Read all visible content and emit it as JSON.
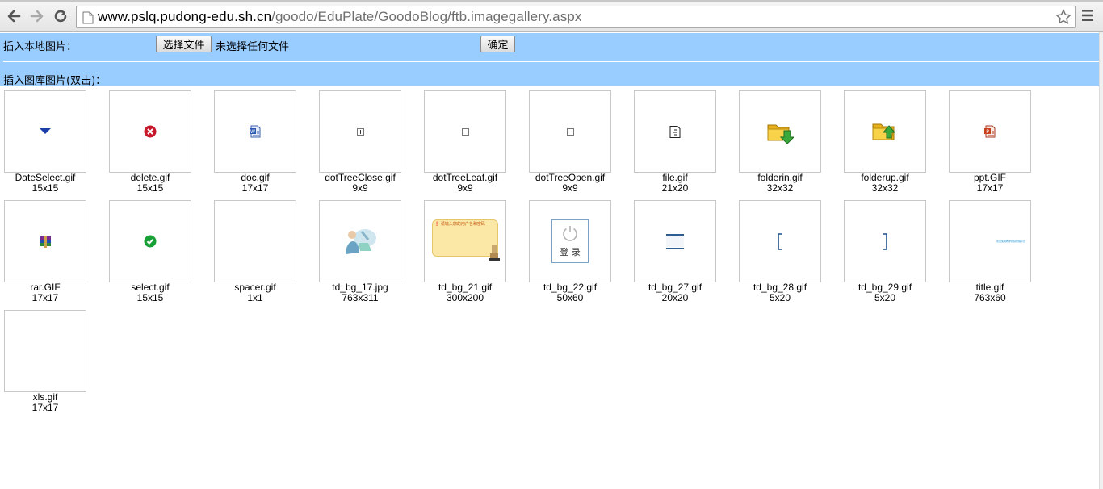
{
  "browser": {
    "url_host": "www.pslq.pudong-edu.sh.cn",
    "url_path": "/goodo/EduPlate/GoodoBlog/ftb.imagegallery.aspx"
  },
  "upload": {
    "label": "插入本地图片：",
    "choose_button": "选择文件",
    "no_file_text": "未选择任何文件",
    "ok_button": "确定"
  },
  "gallery": {
    "label": "插入图库图片(双击)：",
    "images": [
      {
        "name": "DateSelect.gif",
        "size": "15x15",
        "icon": "date-select-icon"
      },
      {
        "name": "delete.gif",
        "size": "15x15",
        "icon": "delete-icon"
      },
      {
        "name": "doc.gif",
        "size": "17x17",
        "icon": "doc-icon"
      },
      {
        "name": "dotTreeClose.gif",
        "size": "9x9",
        "icon": "tree-close-icon"
      },
      {
        "name": "dotTreeLeaf.gif",
        "size": "9x9",
        "icon": "tree-leaf-icon"
      },
      {
        "name": "dotTreeOpen.gif",
        "size": "9x9",
        "icon": "tree-open-icon"
      },
      {
        "name": "file.gif",
        "size": "21x20",
        "icon": "file-icon"
      },
      {
        "name": "folderin.gif",
        "size": "32x32",
        "icon": "folder-in-icon"
      },
      {
        "name": "folderup.gif",
        "size": "32x32",
        "icon": "folder-up-icon"
      },
      {
        "name": "ppt.GIF",
        "size": "17x17",
        "icon": "ppt-icon"
      },
      {
        "name": "rar.GIF",
        "size": "17x17",
        "icon": "rar-icon"
      },
      {
        "name": "select.gif",
        "size": "15x15",
        "icon": "select-check-icon"
      },
      {
        "name": "spacer.gif",
        "size": "1x1",
        "icon": "spacer-image"
      },
      {
        "name": "td_bg_17.jpg",
        "size": "763x311",
        "icon": "person-illustration"
      },
      {
        "name": "td_bg_21.gif",
        "size": "300x200",
        "icon": "login-notice-image",
        "text": "请输入您的用户名和密码"
      },
      {
        "name": "td_bg_22.gif",
        "size": "50x60",
        "icon": "login-power-icon",
        "text": "登 录"
      },
      {
        "name": "td_bg_27.gif",
        "size": "20x20",
        "icon": "bar-image"
      },
      {
        "name": "td_bg_28.gif",
        "size": "5x20",
        "icon": "left-bracket-image"
      },
      {
        "name": "td_bg_29.gif",
        "size": "5x20",
        "icon": "right-bracket-image"
      },
      {
        "name": "title.gif",
        "size": "763x60",
        "icon": "title-banner-image",
        "text": "欢迎使用教学视频管理平台"
      },
      {
        "name": "xls.gif",
        "size": "17x17",
        "icon": "xls-icon"
      }
    ]
  }
}
